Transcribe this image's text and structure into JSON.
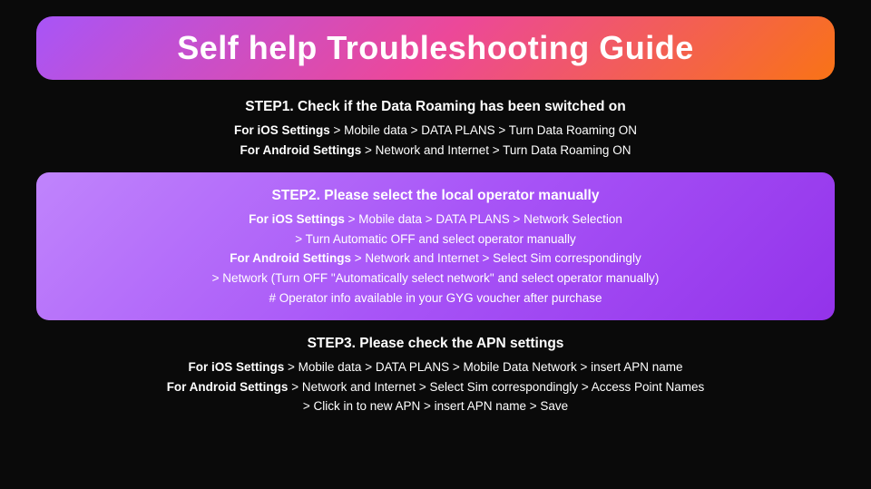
{
  "title": "Self help Troubleshooting Guide",
  "steps": [
    {
      "id": "step1",
      "highlighted": false,
      "title": "STEP1. Check if the Data Roaming has been switched on",
      "lines": [
        {
          "bold_part": "For iOS Settings",
          "normal_part": " > Mobile data > DATA PLANS > Turn Data Roaming ON"
        },
        {
          "bold_part": "For Android Settings",
          "normal_part": " > Network and Internet > Turn Data Roaming ON"
        }
      ]
    },
    {
      "id": "step2",
      "highlighted": true,
      "title": "STEP2. Please select the local operator manually",
      "lines": [
        {
          "bold_part": "For iOS Settings",
          "normal_part": " > Mobile data > DATA PLANS > Network Selection"
        },
        {
          "bold_part": "",
          "normal_part": "> Turn Automatic OFF and select operator manually"
        },
        {
          "bold_part": "For Android Settings",
          "normal_part": " > Network and Internet > Select Sim correspondingly"
        },
        {
          "bold_part": "",
          "normal_part": "> Network (Turn OFF \"Automatically select network\" and select operator manually)"
        },
        {
          "bold_part": "",
          "normal_part": "# Operator info available in your GYG voucher after purchase"
        }
      ]
    },
    {
      "id": "step3",
      "highlighted": false,
      "title": "STEP3. Please check the APN settings",
      "lines": [
        {
          "bold_part": "For iOS Settings",
          "normal_part": " > Mobile data > DATA PLANS > Mobile Data Network > insert APN name"
        },
        {
          "bold_part": "For Android Settings",
          "normal_part": " > Network and Internet > Select Sim correspondingly > Access Point Names"
        },
        {
          "bold_part": "",
          "normal_part": "> Click in to new APN > insert APN name > Save"
        }
      ]
    }
  ]
}
